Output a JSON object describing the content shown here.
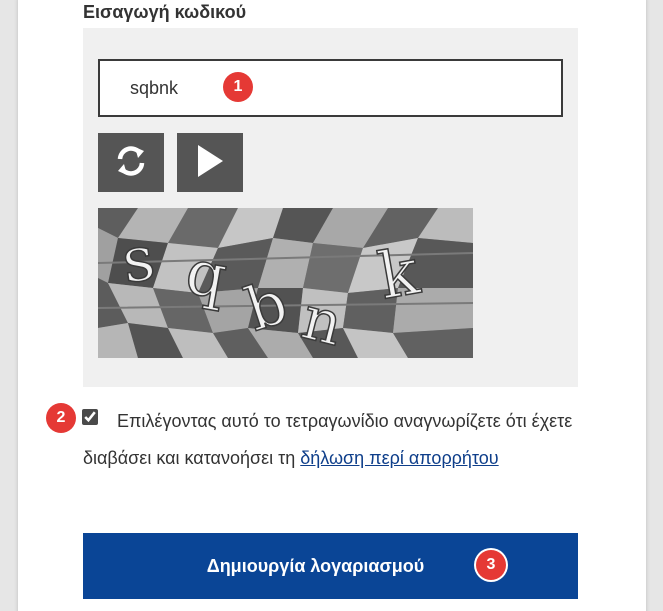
{
  "captcha": {
    "heading": "Εισαγωγή κωδικού",
    "input_value": "sqbnk",
    "image_text": "sqbnk",
    "refresh_icon": "refresh-icon",
    "play_icon": "play-audio-icon"
  },
  "consent": {
    "checked": true,
    "text": "Επιλέγοντας αυτό το τετραγωνίδιο αναγνωρίζετε ότι έχετε διαβάσει και κατανοήσει τη",
    "link_text": "δήλωση περί απορρήτου"
  },
  "submit": {
    "label": "Δημιουργία λογαριασμού"
  },
  "badges": {
    "one": "1",
    "two": "2",
    "three": "3"
  },
  "colors": {
    "primary_button": "#0a4596",
    "badge": "#e53935",
    "link": "#0e3e8a",
    "control_button": "#555555"
  }
}
